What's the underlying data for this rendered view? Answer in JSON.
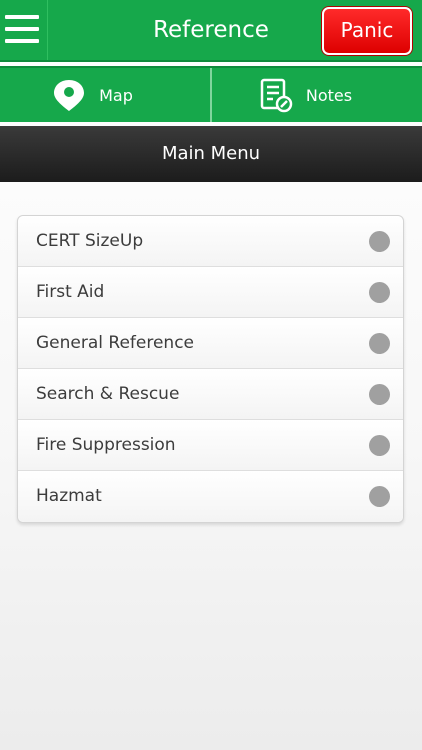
{
  "header": {
    "title": "Reference",
    "panic_label": "Panic"
  },
  "tabs": [
    {
      "label": "Map",
      "icon": "map-pin-icon"
    },
    {
      "label": "Notes",
      "icon": "notes-icon"
    }
  ],
  "section": {
    "title": "Main Menu"
  },
  "menu": {
    "items": [
      {
        "label": "CERT SizeUp"
      },
      {
        "label": "First Aid"
      },
      {
        "label": "General Reference"
      },
      {
        "label": "Search & Rescue"
      },
      {
        "label": "Fire Suppression"
      },
      {
        "label": "Hazmat"
      }
    ]
  },
  "colors": {
    "brand_green": "#16a84b",
    "panic_red": "#ff1f1f",
    "header_dark": "#2a2a2a",
    "indicator_gray": "#a0a0a0"
  }
}
